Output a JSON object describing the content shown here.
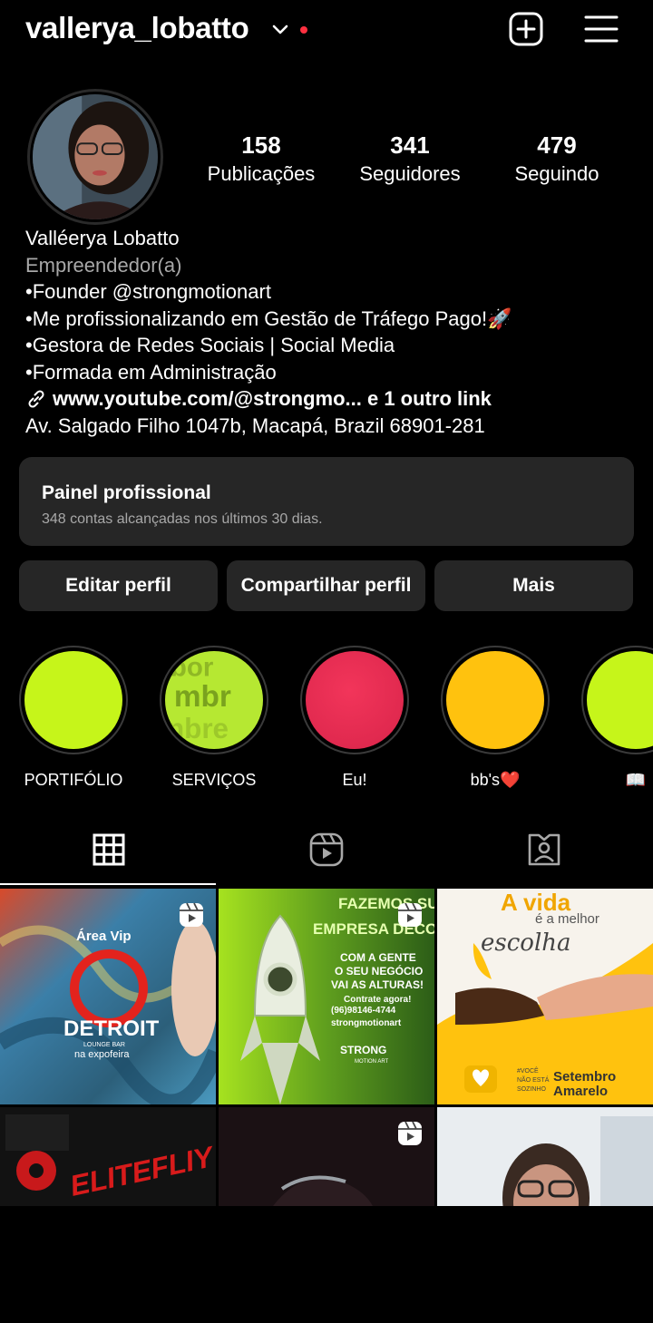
{
  "header": {
    "username": "vallerya_lobatto"
  },
  "stats": [
    {
      "value": "158",
      "label": "Publicações"
    },
    {
      "value": "341",
      "label": "Seguidores"
    },
    {
      "value": "479",
      "label": "Seguindo"
    }
  ],
  "bio": {
    "name": "Valléerya Lobatto",
    "category": "Empreendedor(a)",
    "lines": [
      "•Founder @strongmotionart",
      "•Me profissionalizando em Gestão de Tráfego Pago!🚀",
      "•Gestora de Redes Sociais | Social Media",
      "•Formada em Administração"
    ],
    "link": "www.youtube.com/@strongmo... e 1 outro link",
    "address": "Av. Salgado Filho 1047b, Macapá, Brazil 68901-281"
  },
  "dashboard": {
    "title": "Painel profissional",
    "subtitle": "348 contas alcançadas nos últimos 30 dias."
  },
  "buttons": {
    "edit": "Editar perfil",
    "share": "Compartilhar perfil",
    "more": "Mais"
  },
  "highlights": [
    {
      "label": "PORTIFÓLIO",
      "color": "#c6f51a"
    },
    {
      "label": "SERVIÇOS",
      "color": "#b6e832"
    },
    {
      "label": "Eu!",
      "color": "#f0294e"
    },
    {
      "label": "bb's❤️",
      "color": "#ffc20e"
    },
    {
      "label": "📖",
      "color": "#c6f51a"
    }
  ],
  "posts": [
    {
      "line1": "Área Vip",
      "line2": "DETROIT",
      "line3": "LOUNGE BAR",
      "line4": "na expofeira",
      "reel": true
    },
    {
      "line1": "FAZEMOS SUA",
      "line2": "EMPRESA DECOLAR",
      "line3": "COM A GENTE",
      "line4": "O SEU NEGÓCIO",
      "line5": "VAI AS ALTURAS!",
      "line6": "Contrate agora!",
      "line7": "(96)98146-4744",
      "line8": "strongmotionart",
      "line9": "STRONG",
      "line10": "MOTION ART",
      "reel": true
    },
    {
      "line1": "A vida",
      "line2": "é a melhor",
      "line3": "escolha",
      "line4": "#VOCÊ",
      "line5": "NÃO ESTÁ",
      "line6": "SOZINHO",
      "line7": "Setembro",
      "line8": "Amarelo",
      "reel": false
    },
    {
      "line1": "ELITEFLIY",
      "reel": false
    },
    {
      "line1": "",
      "reel": true
    },
    {
      "line1": "",
      "reel": false
    }
  ]
}
